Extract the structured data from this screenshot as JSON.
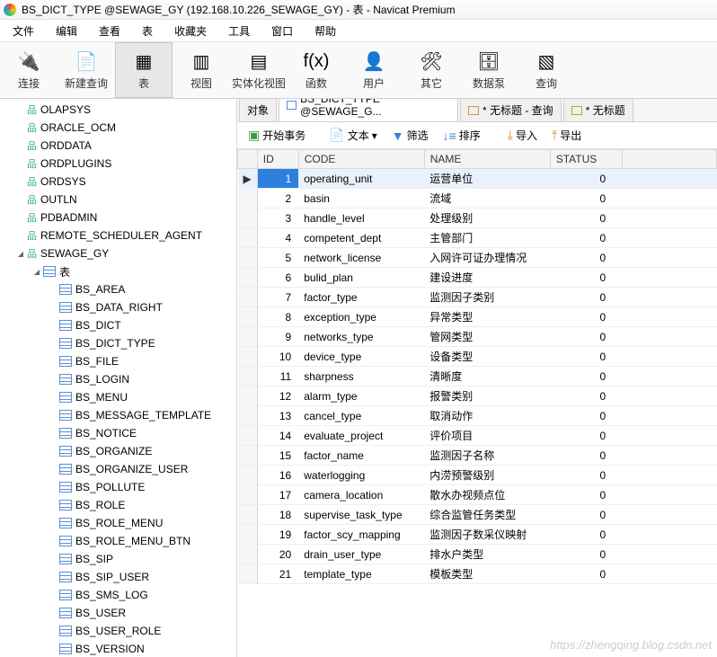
{
  "window": {
    "title": "BS_DICT_TYPE @SEWAGE_GY (192.168.10.226_SEWAGE_GY) - 表 - Navicat Premium"
  },
  "menu": [
    "文件",
    "编辑",
    "查看",
    "表",
    "收藏夹",
    "工具",
    "窗口",
    "帮助"
  ],
  "toolbar": [
    {
      "label": "连接",
      "icon": "🔌"
    },
    {
      "label": "新建查询",
      "icon": "📄"
    },
    {
      "label": "表",
      "icon": "▦",
      "selected": true
    },
    {
      "label": "视图",
      "icon": "▥"
    },
    {
      "label": "实体化视图",
      "icon": "▤"
    },
    {
      "label": "函数",
      "icon": "f(x)"
    },
    {
      "label": "用户",
      "icon": "👤"
    },
    {
      "label": "其它",
      "icon": "🛠"
    },
    {
      "label": "数据泵",
      "icon": "🗄"
    },
    {
      "label": "查询",
      "icon": "▧"
    }
  ],
  "tree": {
    "schemas": [
      "OLAPSYS",
      "ORACLE_OCM",
      "ORDDATA",
      "ORDPLUGINS",
      "ORDSYS",
      "OUTLN",
      "PDBADMIN",
      "REMOTE_SCHEDULER_AGENT"
    ],
    "active_schema": "SEWAGE_GY",
    "folder_label": "表",
    "tables": [
      "BS_AREA",
      "BS_DATA_RIGHT",
      "BS_DICT",
      "BS_DICT_TYPE",
      "BS_FILE",
      "BS_LOGIN",
      "BS_MENU",
      "BS_MESSAGE_TEMPLATE",
      "BS_NOTICE",
      "BS_ORGANIZE",
      "BS_ORGANIZE_USER",
      "BS_POLLUTE",
      "BS_ROLE",
      "BS_ROLE_MENU",
      "BS_ROLE_MENU_BTN",
      "BS_SIP",
      "BS_SIP_USER",
      "BS_SMS_LOG",
      "BS_USER",
      "BS_USER_ROLE",
      "BS_VERSION"
    ]
  },
  "tabs": [
    {
      "label": "对象",
      "kind": "obj"
    },
    {
      "label": "BS_DICT_TYPE @SEWAGE_G...",
      "kind": "table",
      "active": true
    },
    {
      "label": "* 无标题 - 查询",
      "kind": "query"
    },
    {
      "label": "* 无标题",
      "kind": "query"
    }
  ],
  "objbar": {
    "start": "开始事务",
    "text": "文本",
    "text_arrow": "▾",
    "filter": "筛选",
    "sort": "排序",
    "import": "导入",
    "export": "导出"
  },
  "columns": [
    "ID",
    "CODE",
    "NAME",
    "STATUS"
  ],
  "rows": [
    {
      "id": 1,
      "code": "operating_unit",
      "name": "运营单位",
      "status": 0,
      "selected": true
    },
    {
      "id": 2,
      "code": "basin",
      "name": "流域",
      "status": 0
    },
    {
      "id": 3,
      "code": "handle_level",
      "name": "处理级别",
      "status": 0
    },
    {
      "id": 4,
      "code": "competent_dept",
      "name": "主管部门",
      "status": 0
    },
    {
      "id": 5,
      "code": "network_license",
      "name": "入网许可证办理情况",
      "status": 0
    },
    {
      "id": 6,
      "code": "bulid_plan",
      "name": "建设进度",
      "status": 0
    },
    {
      "id": 7,
      "code": "factor_type",
      "name": "监测因子类别",
      "status": 0
    },
    {
      "id": 8,
      "code": "exception_type",
      "name": "异常类型",
      "status": 0
    },
    {
      "id": 9,
      "code": "networks_type",
      "name": "管网类型",
      "status": 0
    },
    {
      "id": 10,
      "code": "device_type",
      "name": "设备类型",
      "status": 0
    },
    {
      "id": 11,
      "code": "sharpness",
      "name": "清晰度",
      "status": 0
    },
    {
      "id": 12,
      "code": "alarm_type",
      "name": "报警类别",
      "status": 0
    },
    {
      "id": 13,
      "code": "cancel_type",
      "name": "取消动作",
      "status": 0
    },
    {
      "id": 14,
      "code": "evaluate_project",
      "name": "评价项目",
      "status": 0
    },
    {
      "id": 15,
      "code": "factor_name",
      "name": "监测因子名称",
      "status": 0
    },
    {
      "id": 16,
      "code": "waterlogging",
      "name": "内涝预警级别",
      "status": 0
    },
    {
      "id": 17,
      "code": "camera_location",
      "name": "散水办视频点位",
      "status": 0
    },
    {
      "id": 18,
      "code": "supervise_task_type",
      "name": "综合监管任务类型",
      "status": 0
    },
    {
      "id": 19,
      "code": "factor_scy_mapping",
      "name": "监测因子数采仪映射",
      "status": 0
    },
    {
      "id": 20,
      "code": "drain_user_type",
      "name": "排水户类型",
      "status": 0
    },
    {
      "id": 21,
      "code": "template_type",
      "name": "模板类型",
      "status": 0
    }
  ],
  "watermark": "https://zhengqing.blog.csdn.net"
}
